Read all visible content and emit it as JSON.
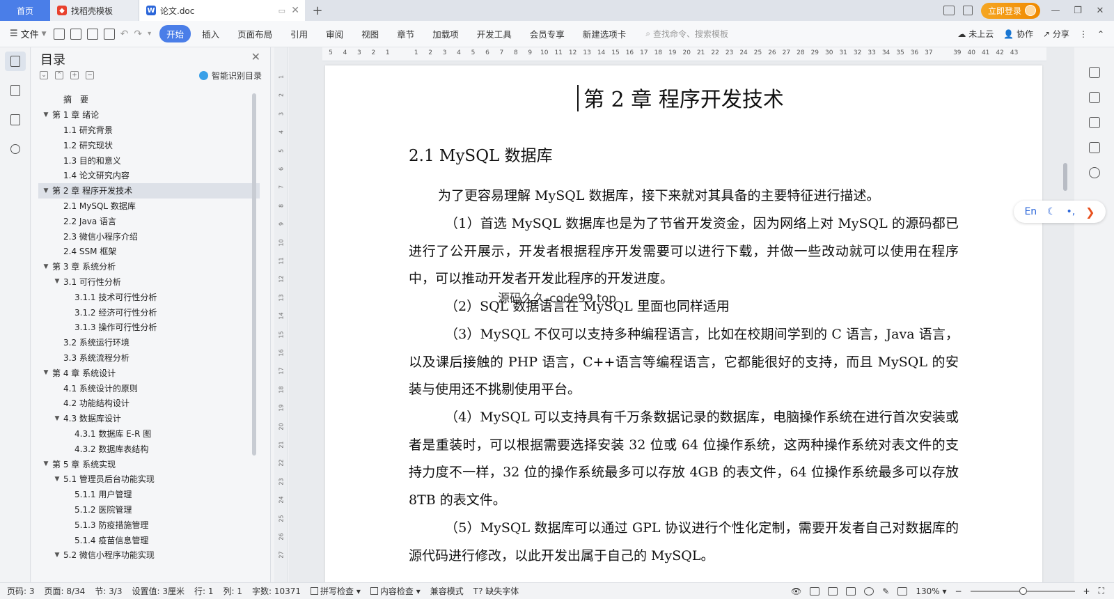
{
  "tabs": {
    "home": "首页",
    "template": "找稻壳模板",
    "document": "论文.doc",
    "new_tab": "+"
  },
  "titlebar": {
    "login": "立即登录"
  },
  "ribbon": {
    "file": "文件",
    "tabs": [
      "开始",
      "插入",
      "页面布局",
      "引用",
      "审阅",
      "视图",
      "章节",
      "加载项",
      "开发工具",
      "会员专享",
      "新建选项卡"
    ],
    "search_placeholder": "查找命令、搜索模板",
    "cloud": "未上云",
    "collab": "协作",
    "share": "分享"
  },
  "toc": {
    "title": "目录",
    "smart": "智能识别目录",
    "items": [
      {
        "text": "摘　要",
        "level": 1,
        "chev": ""
      },
      {
        "text": "第 1 章  绪论",
        "level": 0,
        "chev": "v"
      },
      {
        "text": "1.1  研究背景",
        "level": 1,
        "chev": ""
      },
      {
        "text": "1.2  研究现状",
        "level": 1,
        "chev": ""
      },
      {
        "text": "1.3  目的和意义",
        "level": 1,
        "chev": ""
      },
      {
        "text": "1.4  论文研究内容",
        "level": 1,
        "chev": ""
      },
      {
        "text": "第 2 章  程序开发技术",
        "level": 0,
        "chev": "v",
        "selected": true
      },
      {
        "text": "2.1 MySQL 数据库",
        "level": 1,
        "chev": ""
      },
      {
        "text": "2.2 Java 语言",
        "level": 1,
        "chev": ""
      },
      {
        "text": "2.3  微信小程序介绍",
        "level": 1,
        "chev": ""
      },
      {
        "text": "2.4 SSM 框架",
        "level": 1,
        "chev": ""
      },
      {
        "text": "第 3 章  系统分析",
        "level": 0,
        "chev": "v"
      },
      {
        "text": "3.1 可行性分析",
        "level": 1,
        "chev": "v"
      },
      {
        "text": "3.1.1 技术可行性分析",
        "level": 2,
        "chev": ""
      },
      {
        "text": "3.1.2 经济可行性分析",
        "level": 2,
        "chev": ""
      },
      {
        "text": "3.1.3 操作可行性分析",
        "level": 2,
        "chev": ""
      },
      {
        "text": "3.2 系统运行环境",
        "level": 1,
        "chev": ""
      },
      {
        "text": "3.3 系统流程分析",
        "level": 1,
        "chev": ""
      },
      {
        "text": "第 4 章  系统设计",
        "level": 0,
        "chev": "v"
      },
      {
        "text": "4.1  系统设计的原则",
        "level": 1,
        "chev": ""
      },
      {
        "text": "4.2  功能结构设计",
        "level": 1,
        "chev": ""
      },
      {
        "text": "4.3  数据库设计",
        "level": 1,
        "chev": "v"
      },
      {
        "text": "4.3.1  数据库 E-R 图",
        "level": 2,
        "chev": ""
      },
      {
        "text": "4.3.2  数据库表结构",
        "level": 2,
        "chev": ""
      },
      {
        "text": "第 5 章  系统实现",
        "level": 0,
        "chev": "v"
      },
      {
        "text": "5.1 管理员后台功能实现",
        "level": 1,
        "chev": "v"
      },
      {
        "text": "5.1.1  用户管理",
        "level": 2,
        "chev": ""
      },
      {
        "text": "5.1.2  医院管理",
        "level": 2,
        "chev": ""
      },
      {
        "text": "5.1.3  防疫措施管理",
        "level": 2,
        "chev": ""
      },
      {
        "text": "5.1.4  疫苗信息管理",
        "level": 2,
        "chev": ""
      },
      {
        "text": "5.2  微信小程序功能实现",
        "level": 1,
        "chev": "v"
      }
    ]
  },
  "ruler": {
    "h_numbers": [
      "5",
      "4",
      "3",
      "2",
      "1",
      "",
      "1",
      "2",
      "3",
      "4",
      "5",
      "6",
      "7",
      "8",
      "9",
      "10",
      "11",
      "12",
      "13",
      "14",
      "15",
      "16",
      "17",
      "18",
      "19",
      "20",
      "21",
      "22",
      "23",
      "24",
      "25",
      "26",
      "27",
      "28",
      "29",
      "30",
      "31",
      "32",
      "33",
      "34",
      "35",
      "36",
      "37",
      "",
      "39",
      "40",
      "41",
      "42",
      "43"
    ],
    "v_numbers": [
      "1",
      "2",
      "3",
      "4",
      "5",
      "6",
      "7",
      "8",
      "9",
      "10",
      "11",
      "12",
      "13",
      "14",
      "15",
      "16",
      "17",
      "18",
      "19",
      "20",
      "21",
      "22",
      "23",
      "24",
      "25",
      "26",
      "27"
    ]
  },
  "document": {
    "chapter": "第 2 章  程序开发技术",
    "section": "2.1 MySQL 数据库",
    "paragraphs": [
      "为了更容易理解 MySQL 数据库，接下来就对其具备的主要特征进行描述。",
      "（1）首选 MySQL 数据库也是为了节省开发资金，因为网络上对 MySQL 的源码都已进行了公开展示，开发者根据程序开发需要可以进行下载，并做一些改动就可以使用在程序中，可以推动开发者开发此程序的开发进度。",
      "（2）SQL 数据语言在 MySQL 里面也同样适用",
      "（3）MySQL 不仅可以支持多种编程语言，比如在校期间学到的 C 语言，Java 语言，以及课后接触的 PHP 语言，C++语言等编程语言，它都能很好的支持，而且 MySQL 的安装与使用还不挑剔使用平台。",
      "（4）MySQL 可以支持具有千万条数据记录的数据库，电脑操作系统在进行首次安装或者是重装时，可以根据需要选择安装 32 位或 64 位操作系统，这两种操作系统对表文件的支持力度不一样，32 位的操作系统最多可以存放 4GB 的表文件，64 位操作系统最多可以存放 8TB 的表文件。",
      "（5）MySQL 数据库可以通过 GPL 协议进行个性化定制，需要开发者自己对数据库的源代码进行修改，以此开发出属于自己的 MySQL。"
    ],
    "watermark": "源码久久-code99.top"
  },
  "floatbar": {
    "lang": "En"
  },
  "status": {
    "page_code": "页码: 3",
    "page": "页面: 8/34",
    "section": "节: 3/3",
    "setting": "设置值: 3厘米",
    "row": "行: 1",
    "col": "列: 1",
    "words": "字数: 10371",
    "spell": "拼写检查",
    "content": "内容检查",
    "compat": "兼容模式",
    "missing_font": "缺失字体",
    "zoom": "130%"
  }
}
